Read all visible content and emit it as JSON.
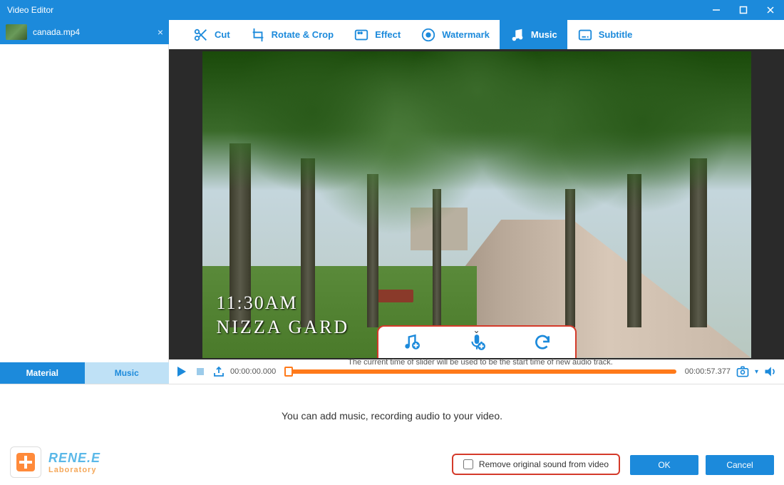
{
  "window": {
    "title": "Video Editor"
  },
  "file_tab": {
    "name": "canada.mp4"
  },
  "toolbar": {
    "cut": "Cut",
    "rotate_crop": "Rotate & Crop",
    "effect": "Effect",
    "watermark": "Watermark",
    "music": "Music",
    "subtitle": "Subtitle"
  },
  "side_tabs": {
    "material": "Material",
    "music": "Music"
  },
  "preview": {
    "overlay_time": "11:30AM",
    "overlay_place": "NIZZA GARD"
  },
  "timeline": {
    "start": "00:00:00.000",
    "end": "00:00:57.377",
    "hint": "The current time of slider will be used to be the start time of new audio track."
  },
  "bottom": {
    "help": "You can add music, recording audio to your video.",
    "brand_line1": "RENE.E",
    "brand_line2": "Laboratory",
    "remove_sound_label": "Remove original sound from video",
    "ok": "OK",
    "cancel": "Cancel"
  }
}
